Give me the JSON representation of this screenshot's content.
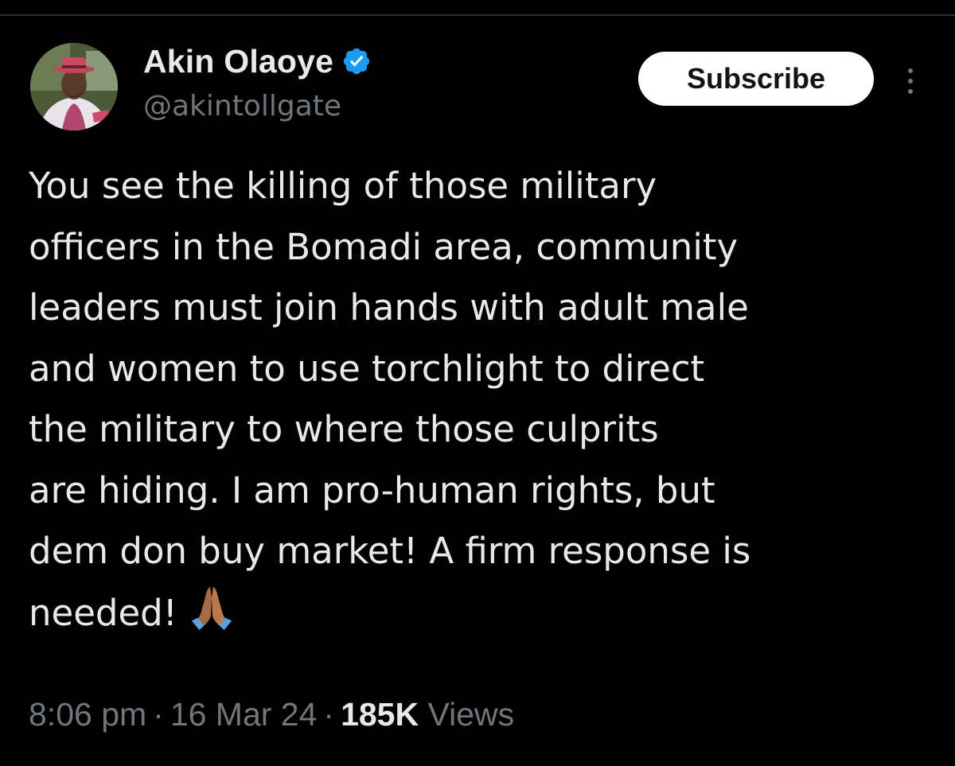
{
  "colors": {
    "background": "#000000",
    "primary_text": "#e7e9ea",
    "secondary_text": "#71767b",
    "verified_blue": "#1d9bf0",
    "subscribe_bg": "#ffffff",
    "subscribe_text": "#0f1419"
  },
  "author": {
    "display_name": "Akin Olaoye",
    "handle": "@akintollgate",
    "verified": true,
    "verified_icon": "verified-badge-icon"
  },
  "actions": {
    "subscribe_label": "Subscribe",
    "more_icon": "more-options-icon"
  },
  "tweet": {
    "lines": [
      "You see the killing of those military",
      "officers in the Bomadi area, community",
      "leaders must join hands with adult male",
      "and women to use torchlight to direct",
      "the military to where those culprits",
      "are hiding. I am pro-human rights, but",
      "dem don buy market! A firm response is",
      "needed!"
    ],
    "emoji": "folded-hands-icon"
  },
  "meta": {
    "time": "8:06 pm",
    "separator": "·",
    "date": "16 Mar 24",
    "views_count": "185K",
    "views_label": "Views"
  }
}
